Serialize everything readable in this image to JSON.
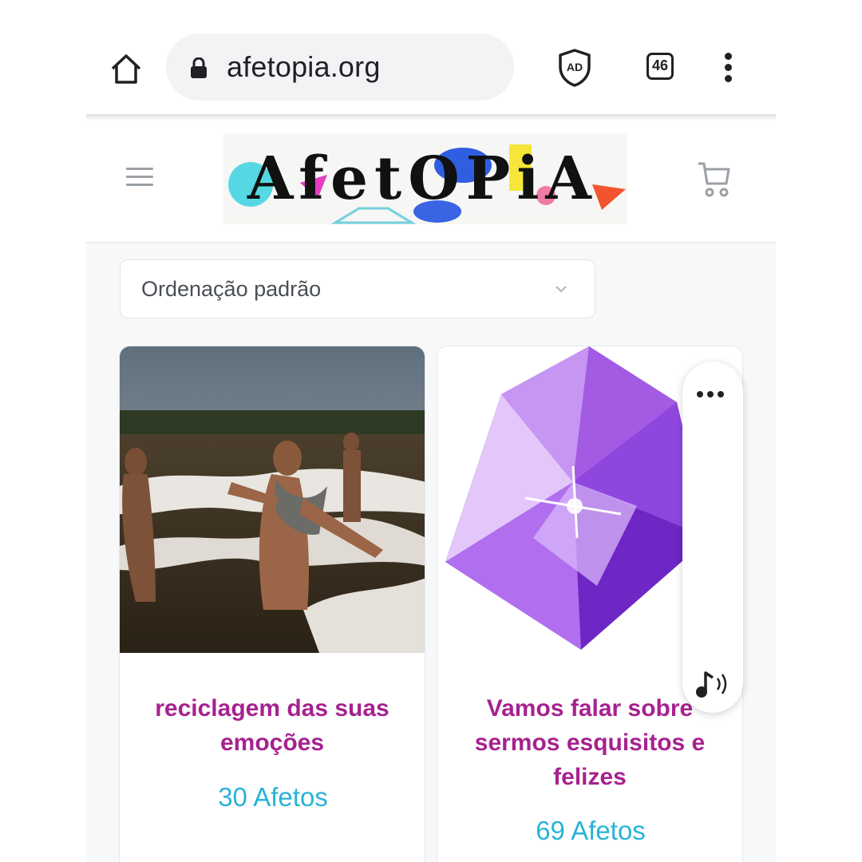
{
  "browser": {
    "url": "afetopia.org",
    "tab_count": "46"
  },
  "site": {
    "logo_text": "AfetOPiA",
    "sort": {
      "selected": "Ordenação padrão"
    },
    "products": [
      {
        "title": "reciclagem das suas emoções",
        "count": "30 Afetos"
      },
      {
        "title": "Vamos falar sobre sermos esquisitos e felizes",
        "count": "69 Afetos"
      }
    ]
  },
  "colors": {
    "title_color": "#a6228f",
    "count_color": "#29b3d8"
  },
  "icons": {
    "home": "home-icon",
    "lock": "lock-icon",
    "adblock": "ad-shield-icon",
    "tabs": "tab-switcher-icon",
    "menu": "more-vert-icon",
    "hamburger": "hamburger-menu-icon",
    "cart": "cart-icon",
    "chevron": "chevron-down-icon",
    "dots": "more-horiz-icon",
    "audio": "audio-note-icon"
  }
}
